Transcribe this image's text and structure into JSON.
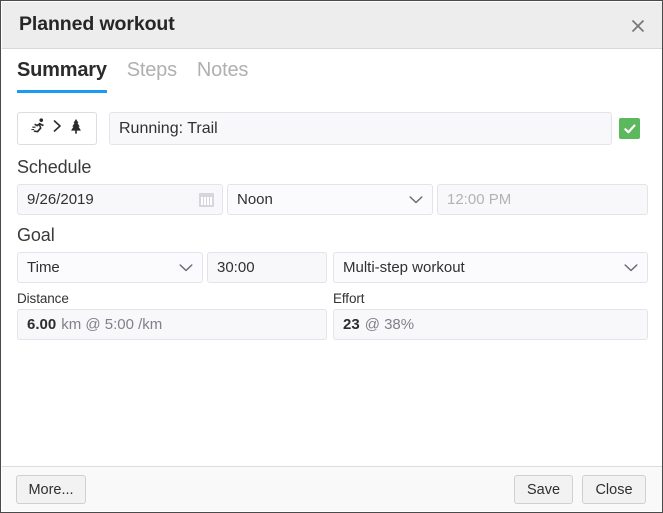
{
  "window": {
    "title": "Planned workout",
    "close_icon": "close-icon"
  },
  "tabs": [
    {
      "label": "Summary",
      "active": true
    },
    {
      "label": "Steps",
      "active": false
    },
    {
      "label": "Notes",
      "active": false
    }
  ],
  "sport": {
    "icons": [
      "running-icon",
      "chevron-right-icon",
      "tree-icon"
    ],
    "name": "Running: Trail",
    "completed_checkbox": {
      "checked": true,
      "color": "#5cb85c"
    }
  },
  "schedule": {
    "label": "Schedule",
    "date": "9/26/2019",
    "date_picker_icon": "calendar-icon",
    "time_of_day": "Noon",
    "time_value": "12:00 PM"
  },
  "goal": {
    "label": "Goal",
    "type": "Time",
    "value": "30:00",
    "structure": "Multi-step workout"
  },
  "distance": {
    "label": "Distance",
    "value": "6.00",
    "detail": "km @ 5:00 /km"
  },
  "effort": {
    "label": "Effort",
    "value": "23",
    "detail": "@ 38%"
  },
  "footer": {
    "more": "More...",
    "save": "Save",
    "close": "Close"
  },
  "colors": {
    "accent": "#1b9cf0",
    "check_green": "#5cb85c",
    "titlebar_bg": "#ededed",
    "field_bg": "#f8f8fb"
  }
}
